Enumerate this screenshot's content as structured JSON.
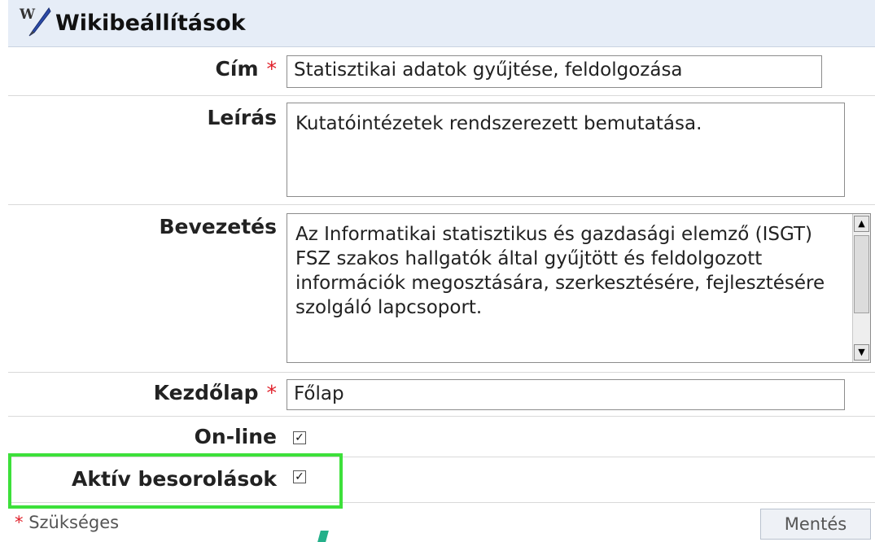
{
  "header": {
    "title": "Wikibeállítások",
    "icon": "wiki-pen-icon"
  },
  "form": {
    "title_label": "Cím",
    "title_value": "Statisztikai adatok gyűjtése, feldolgozása",
    "description_label": "Leírás",
    "description_value": "Kutatóintézetek rendszerezett bemutatása.",
    "intro_label": "Bevezetés",
    "intro_value": "Az Informatikai statisztikus és gazdasági elemző (ISGT) FSZ szakos hallgatók által gyűjtött és feldolgozott információk megosztására, szerkesztésére, fejlesztésére szolgáló lapcsoport.",
    "homepage_label": "Kezdőlap",
    "homepage_value": "Főlap",
    "online_label": "On-line",
    "online_checked": true,
    "active_label": "Aktív besorolások",
    "active_checked": true,
    "required_mark": "*"
  },
  "footer": {
    "required_note": "Szükséges",
    "save_label": "Mentés"
  },
  "colors": {
    "header_bg": "#e6edf7",
    "required": "#e0202a",
    "highlight": "#3de03a"
  }
}
